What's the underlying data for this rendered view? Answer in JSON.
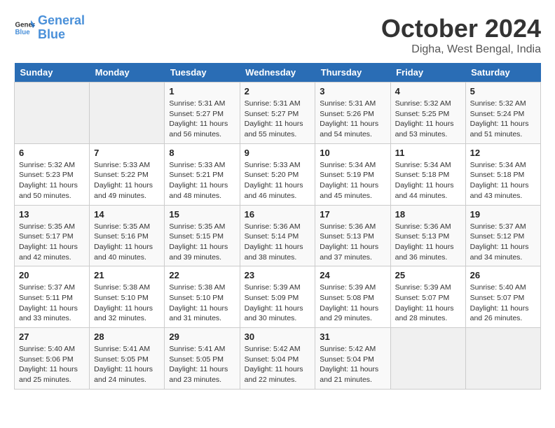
{
  "logo": {
    "text_general": "General",
    "text_blue": "Blue"
  },
  "title": "October 2024",
  "subtitle": "Digha, West Bengal, India",
  "days_of_week": [
    "Sunday",
    "Monday",
    "Tuesday",
    "Wednesday",
    "Thursday",
    "Friday",
    "Saturday"
  ],
  "weeks": [
    [
      {
        "day": "",
        "info": ""
      },
      {
        "day": "",
        "info": ""
      },
      {
        "day": "1",
        "info": "Sunrise: 5:31 AM\nSunset: 5:27 PM\nDaylight: 11 hours and 56 minutes."
      },
      {
        "day": "2",
        "info": "Sunrise: 5:31 AM\nSunset: 5:27 PM\nDaylight: 11 hours and 55 minutes."
      },
      {
        "day": "3",
        "info": "Sunrise: 5:31 AM\nSunset: 5:26 PM\nDaylight: 11 hours and 54 minutes."
      },
      {
        "day": "4",
        "info": "Sunrise: 5:32 AM\nSunset: 5:25 PM\nDaylight: 11 hours and 53 minutes."
      },
      {
        "day": "5",
        "info": "Sunrise: 5:32 AM\nSunset: 5:24 PM\nDaylight: 11 hours and 51 minutes."
      }
    ],
    [
      {
        "day": "6",
        "info": "Sunrise: 5:32 AM\nSunset: 5:23 PM\nDaylight: 11 hours and 50 minutes."
      },
      {
        "day": "7",
        "info": "Sunrise: 5:33 AM\nSunset: 5:22 PM\nDaylight: 11 hours and 49 minutes."
      },
      {
        "day": "8",
        "info": "Sunrise: 5:33 AM\nSunset: 5:21 PM\nDaylight: 11 hours and 48 minutes."
      },
      {
        "day": "9",
        "info": "Sunrise: 5:33 AM\nSunset: 5:20 PM\nDaylight: 11 hours and 46 minutes."
      },
      {
        "day": "10",
        "info": "Sunrise: 5:34 AM\nSunset: 5:19 PM\nDaylight: 11 hours and 45 minutes."
      },
      {
        "day": "11",
        "info": "Sunrise: 5:34 AM\nSunset: 5:18 PM\nDaylight: 11 hours and 44 minutes."
      },
      {
        "day": "12",
        "info": "Sunrise: 5:34 AM\nSunset: 5:18 PM\nDaylight: 11 hours and 43 minutes."
      }
    ],
    [
      {
        "day": "13",
        "info": "Sunrise: 5:35 AM\nSunset: 5:17 PM\nDaylight: 11 hours and 42 minutes."
      },
      {
        "day": "14",
        "info": "Sunrise: 5:35 AM\nSunset: 5:16 PM\nDaylight: 11 hours and 40 minutes."
      },
      {
        "day": "15",
        "info": "Sunrise: 5:35 AM\nSunset: 5:15 PM\nDaylight: 11 hours and 39 minutes."
      },
      {
        "day": "16",
        "info": "Sunrise: 5:36 AM\nSunset: 5:14 PM\nDaylight: 11 hours and 38 minutes."
      },
      {
        "day": "17",
        "info": "Sunrise: 5:36 AM\nSunset: 5:13 PM\nDaylight: 11 hours and 37 minutes."
      },
      {
        "day": "18",
        "info": "Sunrise: 5:36 AM\nSunset: 5:13 PM\nDaylight: 11 hours and 36 minutes."
      },
      {
        "day": "19",
        "info": "Sunrise: 5:37 AM\nSunset: 5:12 PM\nDaylight: 11 hours and 34 minutes."
      }
    ],
    [
      {
        "day": "20",
        "info": "Sunrise: 5:37 AM\nSunset: 5:11 PM\nDaylight: 11 hours and 33 minutes."
      },
      {
        "day": "21",
        "info": "Sunrise: 5:38 AM\nSunset: 5:10 PM\nDaylight: 11 hours and 32 minutes."
      },
      {
        "day": "22",
        "info": "Sunrise: 5:38 AM\nSunset: 5:10 PM\nDaylight: 11 hours and 31 minutes."
      },
      {
        "day": "23",
        "info": "Sunrise: 5:39 AM\nSunset: 5:09 PM\nDaylight: 11 hours and 30 minutes."
      },
      {
        "day": "24",
        "info": "Sunrise: 5:39 AM\nSunset: 5:08 PM\nDaylight: 11 hours and 29 minutes."
      },
      {
        "day": "25",
        "info": "Sunrise: 5:39 AM\nSunset: 5:07 PM\nDaylight: 11 hours and 28 minutes."
      },
      {
        "day": "26",
        "info": "Sunrise: 5:40 AM\nSunset: 5:07 PM\nDaylight: 11 hours and 26 minutes."
      }
    ],
    [
      {
        "day": "27",
        "info": "Sunrise: 5:40 AM\nSunset: 5:06 PM\nDaylight: 11 hours and 25 minutes."
      },
      {
        "day": "28",
        "info": "Sunrise: 5:41 AM\nSunset: 5:05 PM\nDaylight: 11 hours and 24 minutes."
      },
      {
        "day": "29",
        "info": "Sunrise: 5:41 AM\nSunset: 5:05 PM\nDaylight: 11 hours and 23 minutes."
      },
      {
        "day": "30",
        "info": "Sunrise: 5:42 AM\nSunset: 5:04 PM\nDaylight: 11 hours and 22 minutes."
      },
      {
        "day": "31",
        "info": "Sunrise: 5:42 AM\nSunset: 5:04 PM\nDaylight: 11 hours and 21 minutes."
      },
      {
        "day": "",
        "info": ""
      },
      {
        "day": "",
        "info": ""
      }
    ]
  ]
}
